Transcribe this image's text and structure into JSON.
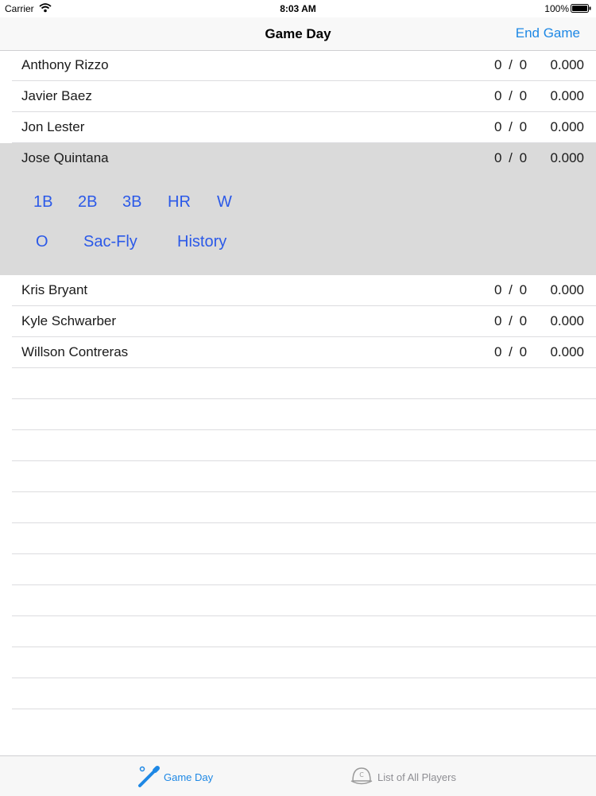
{
  "status_bar": {
    "carrier": "Carrier",
    "time": "8:03 AM",
    "battery": "100%"
  },
  "nav": {
    "title": "Game Day",
    "end_button": "End Game"
  },
  "players": [
    {
      "name": "Anthony Rizzo",
      "count": "0 / 0",
      "avg": "0.000"
    },
    {
      "name": "Javier Baez",
      "count": "0 / 0",
      "avg": "0.000"
    },
    {
      "name": "Jon Lester",
      "count": "0 / 0",
      "avg": "0.000"
    },
    {
      "name": "Jose Quintana",
      "count": "0 / 0",
      "avg": "0.000"
    },
    {
      "name": "Kris Bryant",
      "count": "0 / 0",
      "avg": "0.000"
    },
    {
      "name": "Kyle Schwarber",
      "count": "0 / 0",
      "avg": "0.000"
    },
    {
      "name": "Willson Contreras",
      "count": "0 / 0",
      "avg": "0.000"
    }
  ],
  "actions": {
    "single": "1B",
    "double": "2B",
    "triple": "3B",
    "homerun": "HR",
    "walk": "W",
    "out": "O",
    "sac_fly": "Sac-Fly",
    "history": "History"
  },
  "tabs": [
    {
      "label": "Game Day",
      "icon": "baseball-bat-icon",
      "active": true
    },
    {
      "label": "List of All Players",
      "icon": "baseball-cap-icon",
      "active": false
    }
  ],
  "colors": {
    "accent": "#1e88e5",
    "action": "#2b59e8",
    "expanded_bg": "#dadada"
  }
}
